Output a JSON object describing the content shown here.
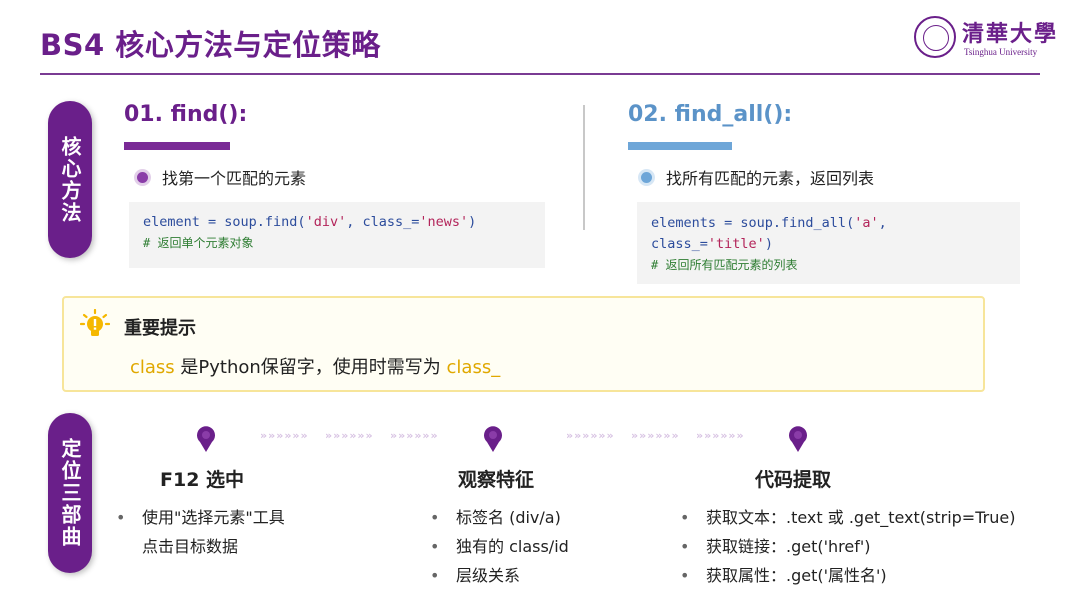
{
  "header": {
    "title": "BS4 核心方法与定位策略",
    "logo_cn": "清華大學",
    "logo_en": "Tsinghua University"
  },
  "side_tabs": {
    "methods": "核心方法",
    "locate": "定位三部曲"
  },
  "find": {
    "heading": "01. find():",
    "bullet": "找第一个匹配的元素",
    "code": {
      "line1_pre": "element = soup.find(",
      "line1_s1": "'div'",
      "line1_mid": ", class_=",
      "line1_s2": "'news'",
      "line1_post": ")",
      "comment": "# 返回单个元素对象"
    }
  },
  "find_all": {
    "heading": "02. find_all():",
    "bullet": "找所有匹配的元素，返回列表",
    "code": {
      "line1_pre": "elements = soup.find_all(",
      "line1_s1": "'a'",
      "line1_post": ",",
      "line2_pre": "class_=",
      "line2_s1": "'title'",
      "line2_post": ")",
      "comment": "# 返回所有匹配元素的列表"
    }
  },
  "tip": {
    "title": "重要提示",
    "kw1": "class",
    "middle": " 是Python保留字，使用时需写为 ",
    "kw2": "class_"
  },
  "steps": [
    {
      "title": "F12 选中",
      "items": [
        "使用\"选择元素\"工具",
        "点击目标数据"
      ]
    },
    {
      "title": "观察特征",
      "items": [
        "标签名 (div/a)",
        "独有的 class/id",
        "层级关系"
      ]
    },
    {
      "title": "代码提取",
      "items": [
        "获取文本：.text 或 .get_text(strip=True)",
        "获取链接：.get('href')",
        "获取属性：.get('属性名')"
      ]
    }
  ],
  "chevrons": "»»»»»»",
  "colors": {
    "brand_purple": "#6a1f8a",
    "accent_blue": "#5b93c8",
    "tip_yellow": "#e0a800"
  },
  "icons": {
    "tip": "lightbulb-icon",
    "step": "map-pin-icon",
    "logo": "university-seal-icon"
  }
}
